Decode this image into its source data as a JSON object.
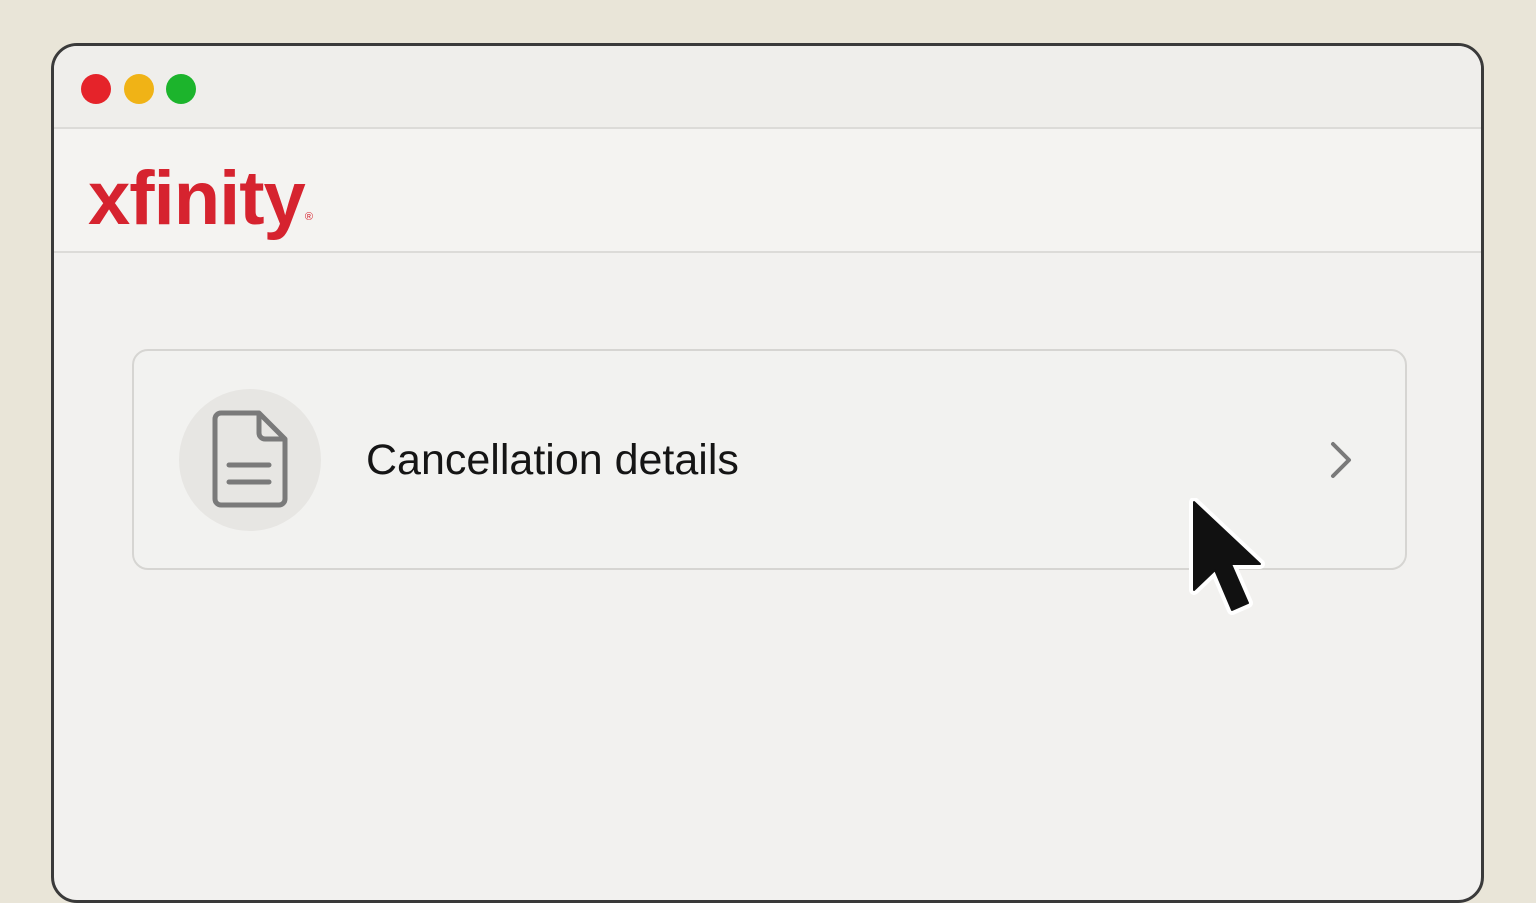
{
  "window": {
    "controls": {
      "close_color": "#e5232a",
      "minimize_color": "#f0b316",
      "zoom_color": "#1cb42c"
    }
  },
  "header": {
    "logo": {
      "text": "xfinity",
      "registered_mark": "®",
      "color": "#d6232f"
    }
  },
  "main": {
    "card": {
      "label": "Cancellation details",
      "icon": "document-icon",
      "action_icon": "chevron-right-icon"
    }
  },
  "cursor": {
    "icon": "mouse-pointer-icon"
  },
  "colors": {
    "background": "#e9e5d8",
    "window_bg": "#f2f1ef",
    "border": "#3a3a3a",
    "text": "#151515",
    "icon_gray": "#7a7a7a"
  }
}
